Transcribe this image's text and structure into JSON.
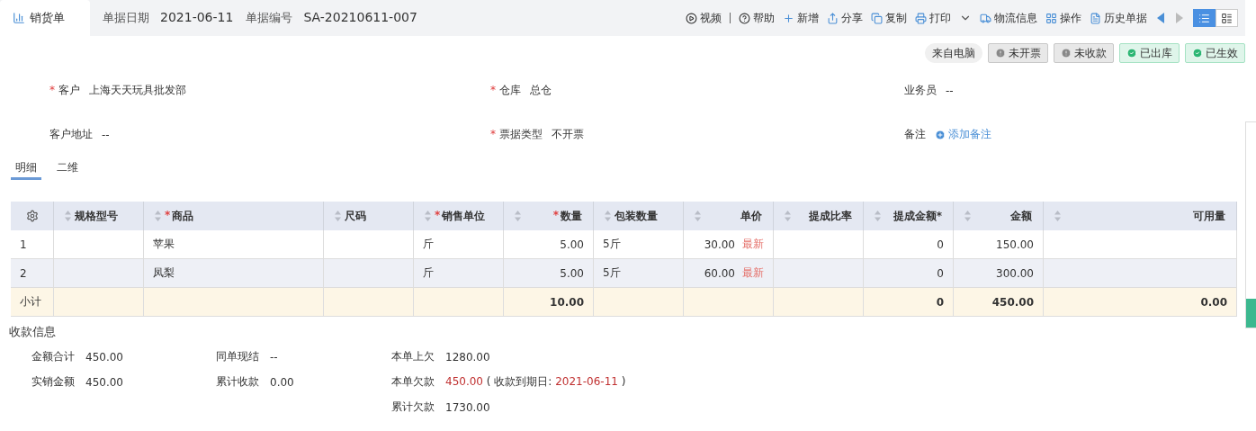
{
  "header": {
    "title": "销货单",
    "fields": [
      {
        "label": "单据日期",
        "value": "2021-06-11"
      },
      {
        "label": "单据编号",
        "value": "SA-20210611-007"
      }
    ],
    "toolbar": [
      {
        "kind": "video",
        "label": "视频"
      },
      {
        "kind": "help",
        "label": "帮助"
      },
      {
        "kind": "add",
        "label": "新增"
      },
      {
        "kind": "share",
        "label": "分享"
      },
      {
        "kind": "copy",
        "label": "复制"
      },
      {
        "kind": "print",
        "label": "打印"
      },
      {
        "kind": "logistics",
        "label": "物流信息"
      },
      {
        "kind": "ops",
        "label": "操作"
      },
      {
        "kind": "history",
        "label": "历史单据"
      }
    ],
    "view_modes": [
      {
        "kind": "list",
        "selected": true
      },
      {
        "kind": "detail",
        "selected": false
      }
    ]
  },
  "badges": [
    {
      "kind": "source",
      "label": "来自电脑"
    },
    {
      "kind": "pending",
      "label": "未开票"
    },
    {
      "kind": "pending",
      "label": "未收款"
    },
    {
      "kind": "done",
      "label": "已出库"
    },
    {
      "kind": "done",
      "label": "已生效"
    }
  ],
  "form_rows": [
    [
      {
        "required_mark": "*",
        "label": "客户",
        "value": "上海天天玩具批发部"
      },
      {
        "required_mark": "*",
        "label": "仓库",
        "value": "总仓"
      },
      {
        "label": "业务员",
        "value": "--"
      }
    ],
    [
      {
        "label": "客户地址",
        "value": "--"
      },
      {
        "required_mark": "*",
        "label": "票据类型",
        "value": "不开票"
      },
      {
        "label": "备注",
        "link": "添加备注"
      }
    ]
  ],
  "tabs": [
    {
      "label": "明细",
      "selected": true
    },
    {
      "label": "二维",
      "selected": false
    }
  ],
  "table": {
    "columns": [
      {
        "label": "规格型号"
      },
      {
        "required_mark": "*",
        "label": "商品"
      },
      {
        "label": "尺码"
      },
      {
        "required_mark": "*",
        "label": "销售单位"
      },
      {
        "required_mark": "*",
        "label": "数量"
      },
      {
        "label": "包装数量"
      },
      {
        "label": "单价"
      },
      {
        "label": "提成比率"
      },
      {
        "label": "提成金额*"
      },
      {
        "label": "金额"
      },
      {
        "label": "可用量"
      }
    ],
    "rows": [
      {
        "index": "1",
        "cells": [
          "",
          "苹果",
          "",
          "斤",
          "5.00",
          "5斤",
          "30.00",
          "",
          "0",
          "150.00",
          ""
        ],
        "price_tag": "最新"
      },
      {
        "index": "2",
        "cells": [
          "",
          "凤梨",
          "",
          "斤",
          "5.00",
          "5斤",
          "60.00",
          "",
          "0",
          "300.00",
          ""
        ],
        "price_tag": "最新"
      }
    ],
    "subtotal": {
      "label": "小计",
      "cells": [
        "",
        "",
        "",
        "",
        "10.00",
        "",
        "",
        "",
        "0",
        "450.00",
        "0.00"
      ]
    }
  },
  "payment": {
    "title": "收款信息",
    "columns": [
      [
        {
          "label": "金额合计",
          "value": "450.00"
        },
        {
          "label": "实销金额",
          "value": "450.00"
        }
      ],
      [
        {
          "label": "同单现结",
          "value": "--"
        },
        {
          "label": "累计收款",
          "value": "0.00"
        }
      ],
      [
        {
          "label": "本单上欠",
          "value": "1280.00"
        },
        {
          "label": "本单欠款",
          "value": "450.00",
          "overdue": true,
          "due_open": "(",
          "due_label": "收款到期日:",
          "due_date": "2021-06-11",
          "due_close": ")"
        },
        {
          "label": "累计欠款",
          "value": "1730.00"
        }
      ]
    ]
  }
}
